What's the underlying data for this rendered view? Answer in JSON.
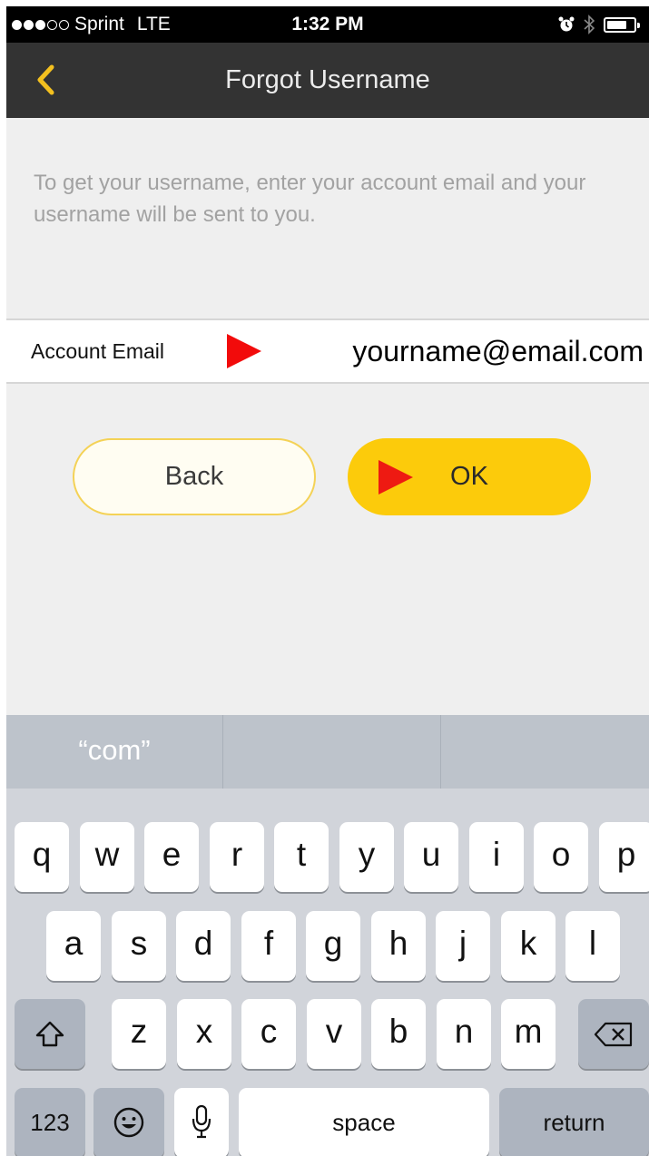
{
  "status_bar": {
    "carrier": "Sprint",
    "network": "LTE",
    "time": "1:32 PM",
    "signal_bars": 3,
    "signal_total": 5,
    "battery_level": 0.75
  },
  "nav": {
    "title": "Forgot Username",
    "back_icon": "chevron-left-icon",
    "accent": "#f3c01f"
  },
  "intro_text": "To get your username, enter your account email and your username will be sent to you.",
  "email": {
    "label": "Account Email",
    "value": "yourname@email.com"
  },
  "buttons": {
    "back_label": "Back",
    "ok_label": "OK"
  },
  "colors": {
    "ok_button": "#fccb0b",
    "back_button_border": "#f4d256",
    "annotation_arrow": "#f20b0b"
  },
  "keyboard": {
    "suggestions": [
      "“com”",
      "",
      ""
    ],
    "row1": [
      "q",
      "w",
      "e",
      "r",
      "t",
      "y",
      "u",
      "i",
      "o",
      "p"
    ],
    "row2": [
      "a",
      "s",
      "d",
      "f",
      "g",
      "h",
      "j",
      "k",
      "l"
    ],
    "row3": [
      "z",
      "x",
      "c",
      "v",
      "b",
      "n",
      "m"
    ],
    "numbers_label": "123",
    "space_label": "space",
    "return_label": "return"
  }
}
